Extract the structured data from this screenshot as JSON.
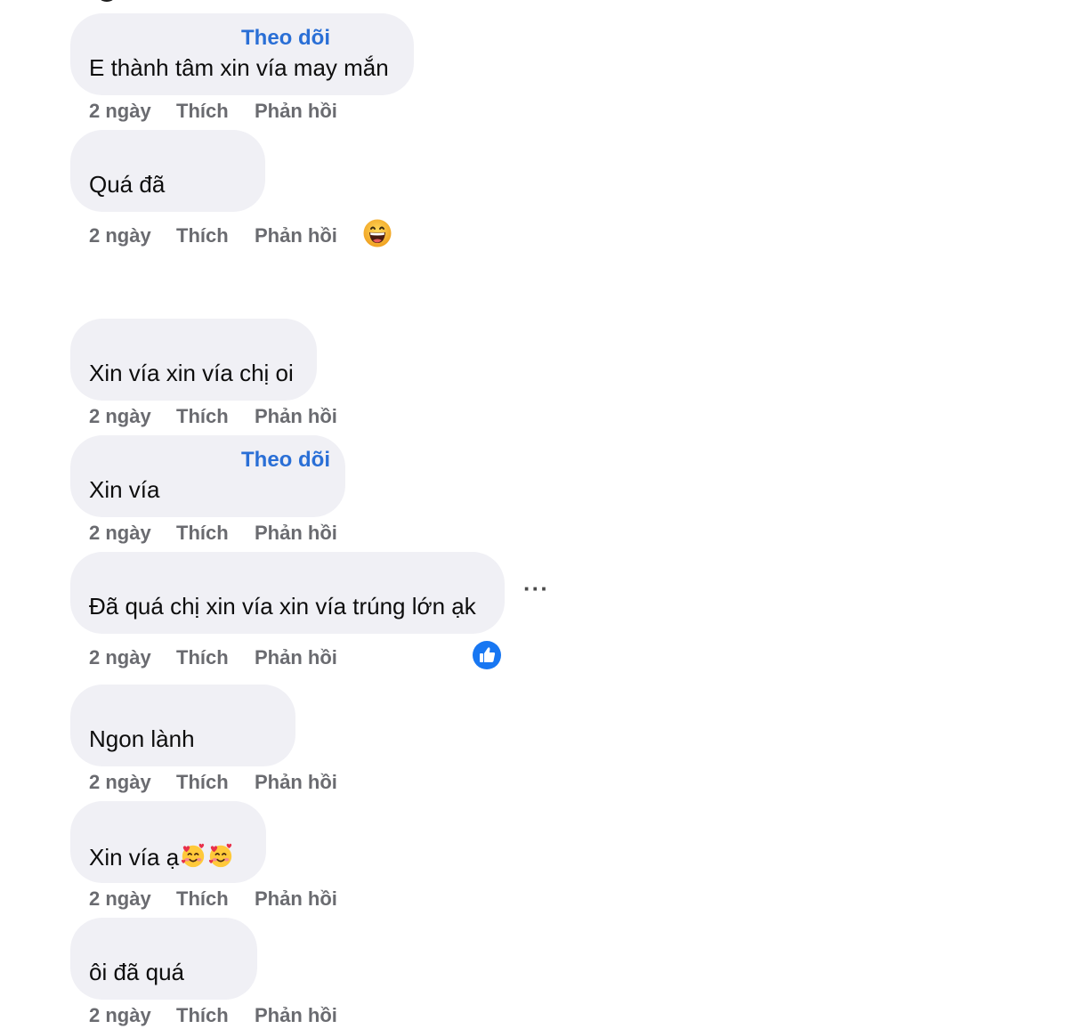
{
  "comments": [
    {
      "follow": "Theo dõi",
      "text": "E thành tâm xin vía may mắn",
      "time": "2 ngày",
      "like": "Thích",
      "reply": "Phản hồi"
    },
    {
      "text": "Quá đã",
      "time": "2 ngày",
      "like": "Thích",
      "reply": "Phản hồi",
      "reaction_icon": "grinning-face-icon"
    },
    {
      "text": "Xin vía xin vía chị oi",
      "time": "2 ngày",
      "like": "Thích",
      "reply": "Phản hồi"
    },
    {
      "follow": "Theo dõi",
      "text": "Xin vía",
      "time": "2 ngày",
      "like": "Thích",
      "reply": "Phản hồi"
    },
    {
      "text": "Đã quá chị xin vía xin vía trúng lớn ạk",
      "time": "2 ngày",
      "like": "Thích",
      "reply": "Phản hồi",
      "reaction_icon": "like-thumb-icon",
      "more_label": "···"
    },
    {
      "text": "Ngon lành",
      "time": "2 ngày",
      "like": "Thích",
      "reply": "Phản hồi"
    },
    {
      "text": "Xin vía ạ",
      "text_emojis": [
        "smiling-face-with-hearts-icon",
        "smiling-face-with-hearts-icon"
      ],
      "time": "2 ngày",
      "like": "Thích",
      "reply": "Phản hồi"
    },
    {
      "text": "ôi đã quá",
      "time": "2 ngày",
      "like": "Thích",
      "reply": "Phản hồi"
    }
  ],
  "colors": {
    "bubble": "#f0f0f5",
    "follow_link": "#2a6fd6",
    "meta_text": "#6a6b70",
    "like_badge": "#1877f2"
  }
}
